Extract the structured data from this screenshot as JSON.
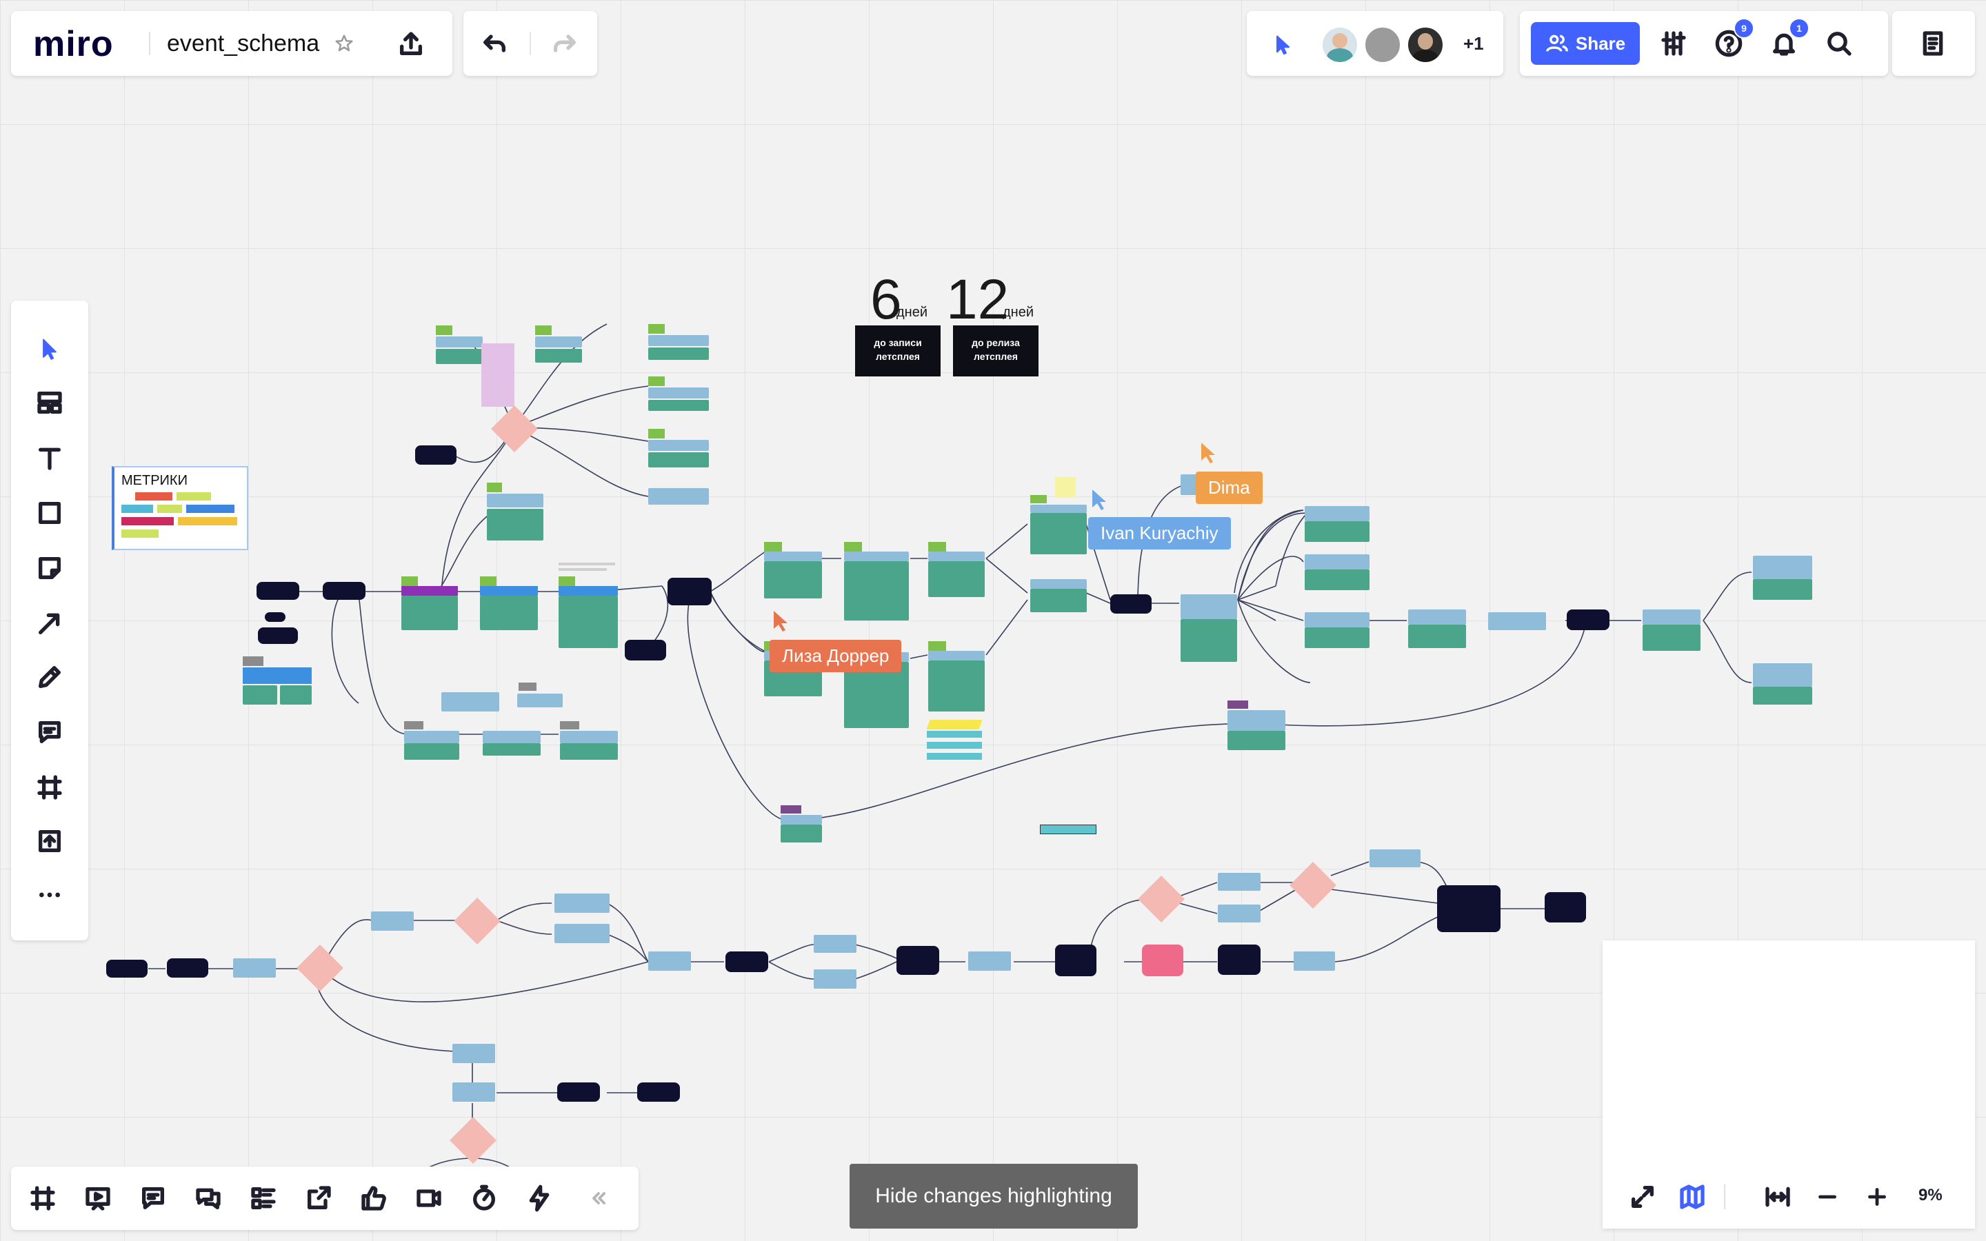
{
  "app": {
    "logo": "miro",
    "board_title": "event_schema"
  },
  "collab": {
    "extra_count": "+1",
    "share_label": "Share",
    "help_badge": "9",
    "notif_badge": "1"
  },
  "counters": [
    {
      "number": "6",
      "unit": "дней",
      "label": "до записи летсплея"
    },
    {
      "number": "12",
      "unit": "дней",
      "label": "до релиза летсплея"
    }
  ],
  "metrics_card": {
    "title": "МЕТРИКИ"
  },
  "cursors": [
    {
      "name": "Dima",
      "color": "#f0a04b"
    },
    {
      "name": "Ivan Kuryachiy",
      "color": "#6ea8e6"
    },
    {
      "name": "Лиза Доррер",
      "color": "#e8744f"
    }
  ],
  "bottom_toast": {
    "label": "Hide changes highlighting"
  },
  "zoom": {
    "level": "9%"
  },
  "colors": {
    "accent": "#4262ff",
    "node_dark": "#0f0f2f",
    "node_blue": "#8fbcd8",
    "node_green": "#4aa58a",
    "diamond": "#f4b9b2",
    "pink": "#ef6a8a"
  }
}
